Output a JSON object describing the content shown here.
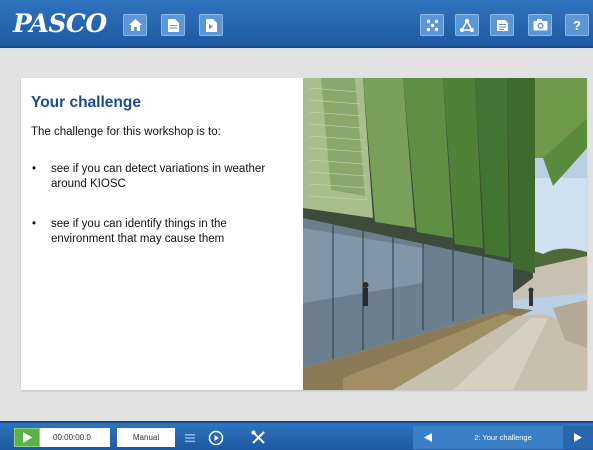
{
  "app": {
    "logo_text": "PASCO"
  },
  "toolbar": {
    "left_icons": [
      "home-icon",
      "document-icon",
      "document-export-icon"
    ],
    "right_icons": [
      "sensor-network-icon",
      "graph-nodes-icon",
      "journal-icon",
      "camera-icon",
      "help-icon"
    ],
    "help_label": "?"
  },
  "slide": {
    "title": "Your challenge",
    "intro": "The challenge for this workshop is to:",
    "bullets": [
      "see if you can detect variations in weather around KIOSC",
      "see if you can identify things in the environment that may cause them"
    ],
    "bullet_glyph": "•",
    "image": "photo of building with green angled facade and paved path"
  },
  "bottombar": {
    "timer": "00:00:00.0",
    "mode": "Manual",
    "page_label": "2: Your challenge"
  },
  "colors": {
    "toolbar_blue": "#2f74bd",
    "play_green": "#5cb246",
    "title_blue": "#1c4b8f"
  }
}
